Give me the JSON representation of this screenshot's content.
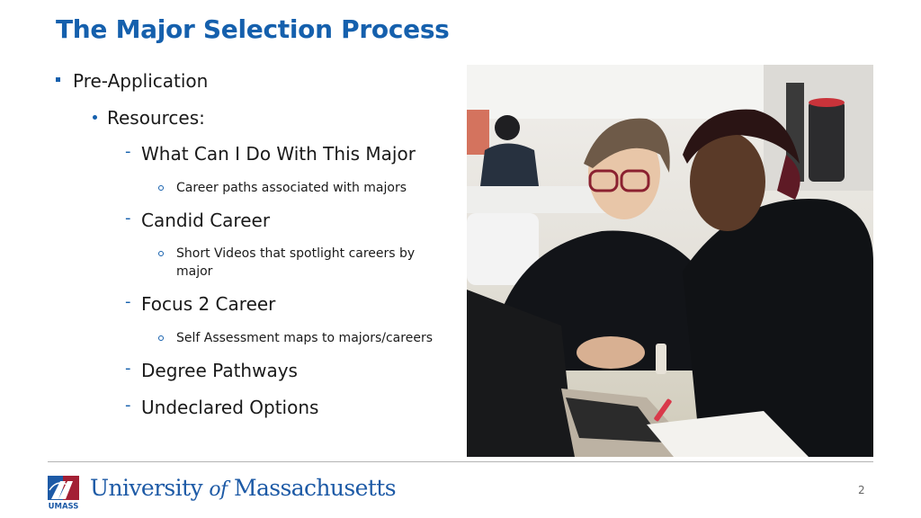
{
  "slide": {
    "title": "The Major Selection Process",
    "page_number": "2",
    "accent_color": "#1560ad"
  },
  "outline": {
    "level1": "Pre-Application",
    "level2": "Resources:",
    "resources": [
      {
        "label": "What Can I Do With This Major",
        "detail": "Career paths associated with majors"
      },
      {
        "label": "Candid Career",
        "detail": "Short Videos that spotlight careers by major"
      },
      {
        "label": "Focus 2 Career",
        "detail": "Self Assessment maps to majors/careers"
      },
      {
        "label": "Degree Pathways"
      },
      {
        "label": "Undeclared Options"
      }
    ],
    "dash_glyph": "-"
  },
  "photo": {
    "description": "Two students smiling and looking at a laptop together in a study area"
  },
  "footer": {
    "university_prefix": "University ",
    "university_of": "of",
    "university_suffix": " Massachusetts",
    "logo_text": "UMASS"
  }
}
